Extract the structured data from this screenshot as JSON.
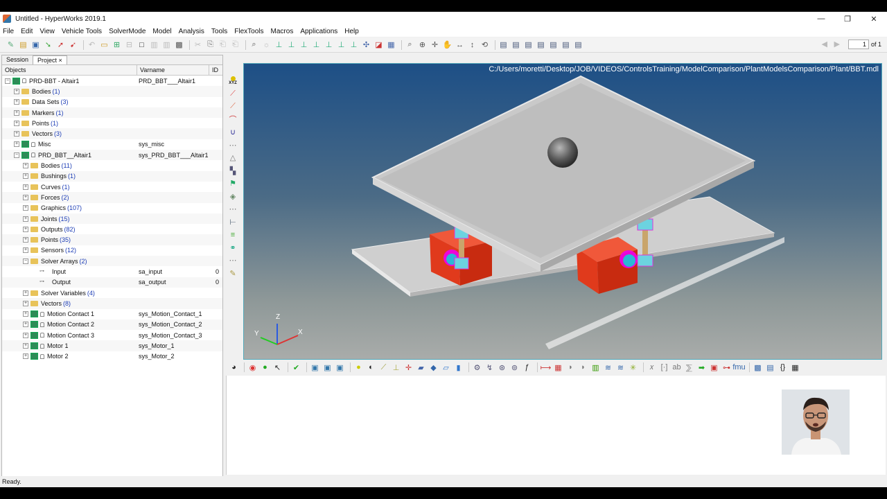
{
  "window": {
    "title": "Untitled - HyperWorks 2019.1",
    "minimize": "—",
    "restore": "❐",
    "close": "✕"
  },
  "menu": [
    "File",
    "Edit",
    "View",
    "Vehicle Tools",
    "SolverMode",
    "Model",
    "Analysis",
    "Tools",
    "FlexTools",
    "Macros",
    "Applications",
    "Help"
  ],
  "pager": {
    "value": "1",
    "of": "of 1"
  },
  "panel": {
    "tabs": [
      "Session",
      "Project ×"
    ],
    "columns": [
      "Objects",
      "Varname",
      "ID"
    ],
    "rows": [
      {
        "name": "PRD-BBT - Altair1",
        "count": "",
        "varname": "PRD_BBT___Altair1",
        "id": "",
        "level": 0,
        "icon": "model"
      },
      {
        "name": "Bodies",
        "count": "(1)",
        "varname": "",
        "id": "",
        "level": 1,
        "icon": "folder"
      },
      {
        "name": "Data Sets",
        "count": "(3)",
        "varname": "",
        "id": "",
        "level": 1,
        "icon": "folder"
      },
      {
        "name": "Markers",
        "count": "(1)",
        "varname": "",
        "id": "",
        "level": 1,
        "icon": "folder"
      },
      {
        "name": "Points",
        "count": "(1)",
        "varname": "",
        "id": "",
        "level": 1,
        "icon": "folder"
      },
      {
        "name": "Vectors",
        "count": "(3)",
        "varname": "",
        "id": "",
        "level": 1,
        "icon": "folder"
      },
      {
        "name": "Misc",
        "count": "",
        "varname": "sys_misc",
        "id": "",
        "level": 1,
        "icon": "model"
      },
      {
        "name": "PRD_BBT__Altair1",
        "count": "",
        "varname": "sys_PRD_BBT___Altair1",
        "id": "",
        "level": 1,
        "icon": "model"
      },
      {
        "name": "Bodies",
        "count": "(11)",
        "varname": "",
        "id": "",
        "level": 2,
        "icon": "folder"
      },
      {
        "name": "Bushings",
        "count": "(1)",
        "varname": "",
        "id": "",
        "level": 2,
        "icon": "folder"
      },
      {
        "name": "Curves",
        "count": "(1)",
        "varname": "",
        "id": "",
        "level": 2,
        "icon": "folder"
      },
      {
        "name": "Forces",
        "count": "(2)",
        "varname": "",
        "id": "",
        "level": 2,
        "icon": "folder"
      },
      {
        "name": "Graphics",
        "count": "(107)",
        "varname": "",
        "id": "",
        "level": 2,
        "icon": "folder"
      },
      {
        "name": "Joints",
        "count": "(15)",
        "varname": "",
        "id": "",
        "level": 2,
        "icon": "folder"
      },
      {
        "name": "Outputs",
        "count": "(82)",
        "varname": "",
        "id": "",
        "level": 2,
        "icon": "folder"
      },
      {
        "name": "Points",
        "count": "(35)",
        "varname": "",
        "id": "",
        "level": 2,
        "icon": "folder"
      },
      {
        "name": "Sensors",
        "count": "(12)",
        "varname": "",
        "id": "",
        "level": 2,
        "icon": "folder"
      },
      {
        "name": "Solver Arrays",
        "count": "(2)",
        "varname": "",
        "id": "",
        "level": 2,
        "icon": "folder"
      },
      {
        "name": "Input",
        "count": "",
        "varname": "sa_input",
        "id": "0",
        "level": 3,
        "icon": "array"
      },
      {
        "name": "Output",
        "count": "",
        "varname": "sa_output",
        "id": "0",
        "level": 3,
        "icon": "array"
      },
      {
        "name": "Solver Variables",
        "count": "(4)",
        "varname": "",
        "id": "",
        "level": 2,
        "icon": "folder"
      },
      {
        "name": "Vectors",
        "count": "(8)",
        "varname": "",
        "id": "",
        "level": 2,
        "icon": "folder"
      },
      {
        "name": "Motion Contact 1",
        "count": "",
        "varname": "sys_Motion_Contact_1",
        "id": "",
        "level": 2,
        "icon": "model"
      },
      {
        "name": "Motion Contact 2",
        "count": "",
        "varname": "sys_Motion_Contact_2",
        "id": "",
        "level": 2,
        "icon": "model"
      },
      {
        "name": "Motion Contact 3",
        "count": "",
        "varname": "sys_Motion_Contact_3",
        "id": "",
        "level": 2,
        "icon": "model"
      },
      {
        "name": "Motor 1",
        "count": "",
        "varname": "sys_Motor_1",
        "id": "",
        "level": 2,
        "icon": "model"
      },
      {
        "name": "Motor 2",
        "count": "",
        "varname": "sys_Motor_2",
        "id": "",
        "level": 2,
        "icon": "model"
      }
    ]
  },
  "viewport": {
    "path": "C:/Users/moretti/Desktop/JOB/VIDEOS/ControlsTraining/ModelComparison/PlantModelsComparison/Plant/BBT.mdl",
    "triad": {
      "z": "Z",
      "y": "Y",
      "x": "X"
    }
  },
  "vertical_tools_label": "XYZ",
  "status": "Ready.",
  "colors": {
    "accent": "#1a3bb5",
    "box_red": "#e03a1c",
    "plate": "#c9c9c9"
  }
}
